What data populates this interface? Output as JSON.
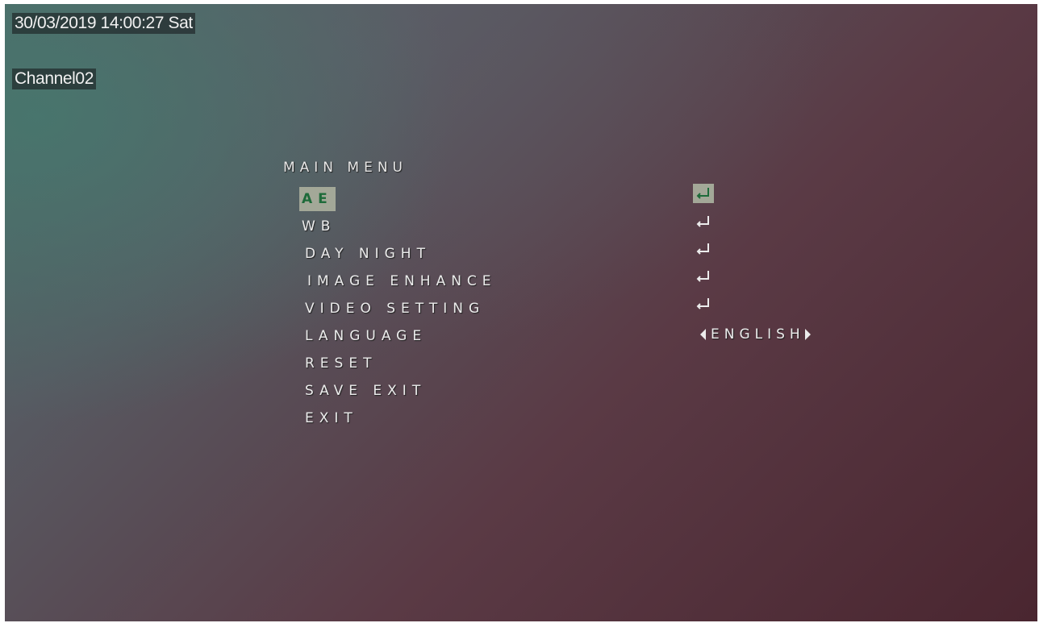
{
  "osd": {
    "datetime": "30/03/2019 14:00:27 Sat",
    "channel": "Channel02"
  },
  "menu": {
    "title": "MAIN MENU",
    "items": [
      {
        "label": "AE",
        "selected": true,
        "action_icon": "enter-icon"
      },
      {
        "label": "WB",
        "selected": false,
        "action_icon": "enter-icon"
      },
      {
        "label": "DAY NIGHT",
        "selected": false,
        "action_icon": "enter-icon"
      },
      {
        "label": "IMAGE ENHANCE",
        "selected": false,
        "action_icon": "enter-icon"
      },
      {
        "label": "VIDEO SETTING",
        "selected": false,
        "action_icon": "enter-icon"
      },
      {
        "label": "LANGUAGE",
        "selected": false,
        "value": "ENGLISH"
      },
      {
        "label": "RESET",
        "selected": false
      },
      {
        "label": "SAVE EXIT",
        "selected": false
      },
      {
        "label": "EXIT",
        "selected": false
      }
    ]
  },
  "colors": {
    "highlight": "#a3a898",
    "selected_text": "#1e6b3a",
    "text": "#ececec"
  }
}
